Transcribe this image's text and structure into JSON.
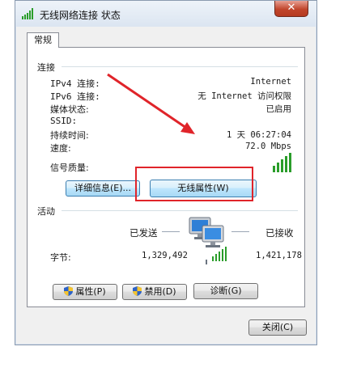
{
  "window": {
    "title": "无线网络连接 状态",
    "close_label": "✕",
    "tab_label": "常规"
  },
  "connection": {
    "section_label": "连接",
    "rows": [
      {
        "label": "IPv4 连接:",
        "value": "Internet"
      },
      {
        "label": "IPv6 连接:",
        "value": "无 Internet 访问权限"
      },
      {
        "label": "媒体状态:",
        "value": "已启用"
      },
      {
        "label": "SSID:",
        "value": ""
      },
      {
        "label": "持续时间:",
        "value": "1 天 06:27:04"
      },
      {
        "label": "速度:",
        "value": "72.0 Mbps"
      }
    ],
    "signal_label": "信号质量:",
    "signal_bars": 5,
    "details_button": "详细信息(E)...",
    "wireless_props_button": "无线属性(W)"
  },
  "activity": {
    "section_label": "活动",
    "sent_label": "已发送",
    "received_label": "已接收",
    "bytes_label": "字节:",
    "bytes_sent": "1,329,492",
    "bytes_received": "1,421,178"
  },
  "buttons": {
    "properties": "属性(P)",
    "disable": "禁用(D)",
    "diagnose": "诊断(G)",
    "close": "关闭(C)"
  },
  "colors": {
    "annotation": "#e0242a",
    "signal": "#2a9d2a",
    "focus_blue": "#3c7fb1"
  }
}
